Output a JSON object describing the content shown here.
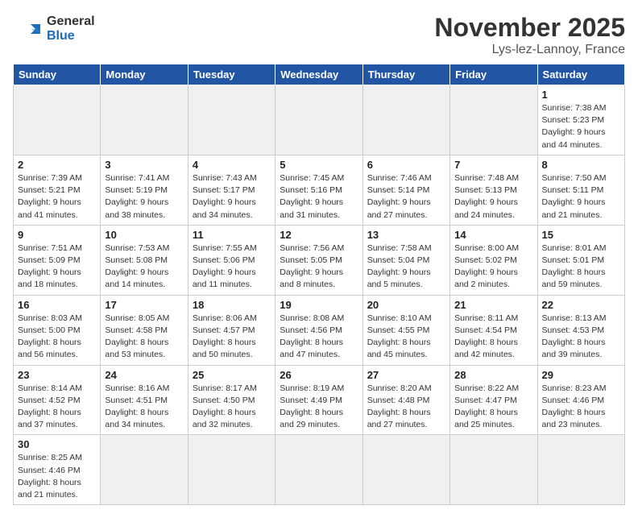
{
  "header": {
    "logo_general": "General",
    "logo_blue": "Blue",
    "month_title": "November 2025",
    "location": "Lys-lez-Lannoy, France"
  },
  "weekdays": [
    "Sunday",
    "Monday",
    "Tuesday",
    "Wednesday",
    "Thursday",
    "Friday",
    "Saturday"
  ],
  "weeks": [
    [
      {
        "day": "",
        "empty": true
      },
      {
        "day": "",
        "empty": true
      },
      {
        "day": "",
        "empty": true
      },
      {
        "day": "",
        "empty": true
      },
      {
        "day": "",
        "empty": true
      },
      {
        "day": "",
        "empty": true
      },
      {
        "day": "1",
        "info": "Sunrise: 7:38 AM\nSunset: 5:23 PM\nDaylight: 9 hours\nand 44 minutes."
      }
    ],
    [
      {
        "day": "2",
        "info": "Sunrise: 7:39 AM\nSunset: 5:21 PM\nDaylight: 9 hours\nand 41 minutes."
      },
      {
        "day": "3",
        "info": "Sunrise: 7:41 AM\nSunset: 5:19 PM\nDaylight: 9 hours\nand 38 minutes."
      },
      {
        "day": "4",
        "info": "Sunrise: 7:43 AM\nSunset: 5:17 PM\nDaylight: 9 hours\nand 34 minutes."
      },
      {
        "day": "5",
        "info": "Sunrise: 7:45 AM\nSunset: 5:16 PM\nDaylight: 9 hours\nand 31 minutes."
      },
      {
        "day": "6",
        "info": "Sunrise: 7:46 AM\nSunset: 5:14 PM\nDaylight: 9 hours\nand 27 minutes."
      },
      {
        "day": "7",
        "info": "Sunrise: 7:48 AM\nSunset: 5:13 PM\nDaylight: 9 hours\nand 24 minutes."
      },
      {
        "day": "8",
        "info": "Sunrise: 7:50 AM\nSunset: 5:11 PM\nDaylight: 9 hours\nand 21 minutes."
      }
    ],
    [
      {
        "day": "9",
        "info": "Sunrise: 7:51 AM\nSunset: 5:09 PM\nDaylight: 9 hours\nand 18 minutes."
      },
      {
        "day": "10",
        "info": "Sunrise: 7:53 AM\nSunset: 5:08 PM\nDaylight: 9 hours\nand 14 minutes."
      },
      {
        "day": "11",
        "info": "Sunrise: 7:55 AM\nSunset: 5:06 PM\nDaylight: 9 hours\nand 11 minutes."
      },
      {
        "day": "12",
        "info": "Sunrise: 7:56 AM\nSunset: 5:05 PM\nDaylight: 9 hours\nand 8 minutes."
      },
      {
        "day": "13",
        "info": "Sunrise: 7:58 AM\nSunset: 5:04 PM\nDaylight: 9 hours\nand 5 minutes."
      },
      {
        "day": "14",
        "info": "Sunrise: 8:00 AM\nSunset: 5:02 PM\nDaylight: 9 hours\nand 2 minutes."
      },
      {
        "day": "15",
        "info": "Sunrise: 8:01 AM\nSunset: 5:01 PM\nDaylight: 8 hours\nand 59 minutes."
      }
    ],
    [
      {
        "day": "16",
        "info": "Sunrise: 8:03 AM\nSunset: 5:00 PM\nDaylight: 8 hours\nand 56 minutes."
      },
      {
        "day": "17",
        "info": "Sunrise: 8:05 AM\nSunset: 4:58 PM\nDaylight: 8 hours\nand 53 minutes."
      },
      {
        "day": "18",
        "info": "Sunrise: 8:06 AM\nSunset: 4:57 PM\nDaylight: 8 hours\nand 50 minutes."
      },
      {
        "day": "19",
        "info": "Sunrise: 8:08 AM\nSunset: 4:56 PM\nDaylight: 8 hours\nand 47 minutes."
      },
      {
        "day": "20",
        "info": "Sunrise: 8:10 AM\nSunset: 4:55 PM\nDaylight: 8 hours\nand 45 minutes."
      },
      {
        "day": "21",
        "info": "Sunrise: 8:11 AM\nSunset: 4:54 PM\nDaylight: 8 hours\nand 42 minutes."
      },
      {
        "day": "22",
        "info": "Sunrise: 8:13 AM\nSunset: 4:53 PM\nDaylight: 8 hours\nand 39 minutes."
      }
    ],
    [
      {
        "day": "23",
        "info": "Sunrise: 8:14 AM\nSunset: 4:52 PM\nDaylight: 8 hours\nand 37 minutes."
      },
      {
        "day": "24",
        "info": "Sunrise: 8:16 AM\nSunset: 4:51 PM\nDaylight: 8 hours\nand 34 minutes."
      },
      {
        "day": "25",
        "info": "Sunrise: 8:17 AM\nSunset: 4:50 PM\nDaylight: 8 hours\nand 32 minutes."
      },
      {
        "day": "26",
        "info": "Sunrise: 8:19 AM\nSunset: 4:49 PM\nDaylight: 8 hours\nand 29 minutes."
      },
      {
        "day": "27",
        "info": "Sunrise: 8:20 AM\nSunset: 4:48 PM\nDaylight: 8 hours\nand 27 minutes."
      },
      {
        "day": "28",
        "info": "Sunrise: 8:22 AM\nSunset: 4:47 PM\nDaylight: 8 hours\nand 25 minutes."
      },
      {
        "day": "29",
        "info": "Sunrise: 8:23 AM\nSunset: 4:46 PM\nDaylight: 8 hours\nand 23 minutes."
      }
    ],
    [
      {
        "day": "30",
        "info": "Sunrise: 8:25 AM\nSunset: 4:46 PM\nDaylight: 8 hours\nand 21 minutes."
      },
      {
        "day": "",
        "empty": true
      },
      {
        "day": "",
        "empty": true
      },
      {
        "day": "",
        "empty": true
      },
      {
        "day": "",
        "empty": true
      },
      {
        "day": "",
        "empty": true
      },
      {
        "day": "",
        "empty": true
      }
    ]
  ]
}
